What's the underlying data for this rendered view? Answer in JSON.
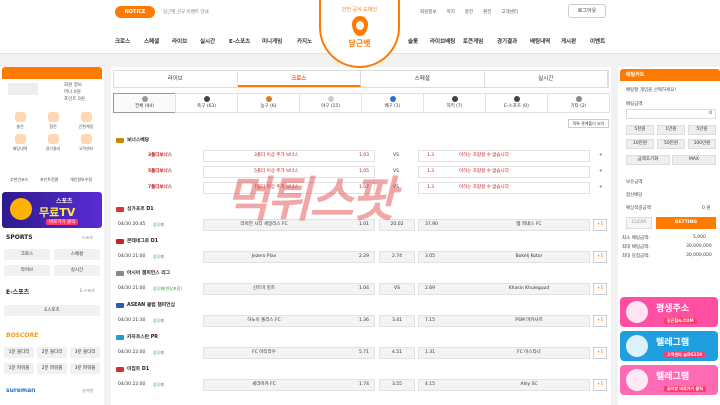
{
  "topbar": {
    "notice_label": "NOTICE",
    "notice_text": "당근벳 신규 이벤트 안내",
    "links": [
      "회원정보",
      "쪽지",
      "충전",
      "환전",
      "고객센터"
    ],
    "logout": "로그아웃"
  },
  "logo": {
    "sub": "안전 공식 도메인",
    "name": "당근벳"
  },
  "nav": {
    "items": [
      "크로스",
      "스페셜",
      "라이브",
      "실시간",
      "E-스포츠",
      "미니게임",
      "카지노",
      "슬롯",
      "라이브배팅",
      "토큰게임",
      "경기결과",
      "배팅내역",
      "게시판",
      "이벤트"
    ]
  },
  "left": {
    "user": {
      "line1": "",
      "line2": "회원 정보",
      "line3": "머니 0원",
      "line4": "포인트 0원"
    },
    "quick": [
      "충전",
      "환전",
      "간편계정",
      "배팅내역",
      "경기결과",
      "고객센터"
    ],
    "links": [
      "추천인코드",
      "포인트전환",
      "개인정보수정"
    ],
    "tv": {
      "t1": "스포츠",
      "t2": "무료TV",
      "t3": "바로가기 클릭"
    },
    "sports_title": "SPORTS",
    "sports_more": "스포츠",
    "sports_btns": [
      "크로스",
      "스페셜",
      "라이브",
      "실시간"
    ],
    "esports_title": "E-스포츠",
    "esports_more": "E-스포츠",
    "esports_btn": "E스포츠",
    "boscore": "BOSCORE",
    "boscore_btns": [
      "1분 볼다리",
      "2분 볼다리",
      "3분 볼다리",
      "1분 파워볼",
      "2분 파워볼",
      "3분 파워볼"
    ],
    "sureman": "sureman",
    "sureman_more": "슈어맨"
  },
  "main": {
    "tabs": [
      "라이브",
      "크로스",
      "스페셜",
      "실시간"
    ],
    "sports": [
      "전체 (94)",
      "축구 (63)",
      "농구 (6)",
      "야구 (15)",
      "배구 (1)",
      "하키 (7)",
      "E-스포츠 (0)",
      "기타 (2)"
    ],
    "relation_btn": "적특 관계폴더 보기",
    "bonus_league": "보너스배당",
    "bonus_rows": [
      {
        "name": "3폴더보너스",
        "detail": "3폴더 이상 추가 보너스",
        "odds": "1.03",
        "vs": "VS",
        "right_odds": "1.3",
        "msg": "이하는 조합할 수 없습니다"
      },
      {
        "name": "5폴더보너스",
        "detail": "5폴더 이상 추가 보너스",
        "odds": "1.05",
        "vs": "VS",
        "right_odds": "1.3",
        "msg": "이하는 조합할 수 없습니다"
      },
      {
        "name": "7폴더보너스",
        "detail": "7폴더 이상 추가 보너스",
        "odds": "1.07",
        "vs": "VS",
        "right_odds": "1.3",
        "msg": "이하는 조합할 수 없습니다"
      }
    ],
    "games": [
      {
        "league": "싱가포르 D1",
        "flag": "#d33",
        "time": "04/30 20:45",
        "type": "승무패",
        "home": "라이언 시티 세일러스 FC",
        "h": "1.01",
        "d": "20.02",
        "a": "37.90",
        "away": "탬 피네스 FC",
        "more": "+5"
      },
      {
        "league": "몬테네그로 D1",
        "flag": "#c22",
        "time": "04/30 21:00",
        "type": "승무패",
        "home": "Jezero Plav",
        "h": "2.29",
        "d": "2.74",
        "a": "3.05",
        "away": "Bokelj Kotor",
        "more": "+5"
      },
      {
        "league": "아시아 챔피언스 리그",
        "flag": "#888",
        "time": "04/30 21:00",
        "type": "승무패(연장포함)",
        "home": "신트미 킹즈",
        "h": "1.04",
        "d": "VS",
        "a": "2.69",
        "away": "Khasin Khuleguud",
        "more": "+5"
      },
      {
        "league": "ASEAN 클럽 챔피언십",
        "flag": "#2a5db0",
        "time": "04/30 21:30",
        "type": "승무패",
        "home": "하노이 폴리스 FC",
        "h": "1.36",
        "d": "3.41",
        "a": "7.15",
        "away": "PSM 마카사르",
        "more": "+5"
      },
      {
        "league": "카자흐스탄 PR",
        "flag": "#1fa0c9",
        "time": "04/30 22:00",
        "type": "승무패",
        "home": "FC 아티라우",
        "h": "5.71",
        "d": "4.51",
        "a": "1.31",
        "away": "FC 아스타나",
        "more": "+5"
      },
      {
        "league": "이집트 D1",
        "flag": "#c33",
        "time": "04/30 22:00",
        "type": "승무패",
        "home": "세라미카 FC",
        "h": "1.74",
        "d": "3.55",
        "a": "4.15",
        "away": "Ahly SC",
        "more": "+5"
      }
    ],
    "watermark": "먹튀스팟"
  },
  "right": {
    "cart_title": "배팅카트",
    "cart_msg": "배팅할 게임을 선택하세요!",
    "amount_label": "배팅금액",
    "amount_value": "0",
    "chips": [
      "5천원",
      "1만원",
      "5만원",
      "10만원",
      "50만원",
      "100만원"
    ],
    "reset": "금액초기화",
    "max": "MAX",
    "hold_label": "보유금액",
    "odds_label": "합산배당",
    "expect_label": "예상적중금액",
    "expect_value": "0 원",
    "clear": "CLEAR",
    "betting": "BETTING",
    "limits": [
      {
        "k": "최소 배팅금액:",
        "v": "5,000"
      },
      {
        "k": "최대 배팅금액:",
        "v": "30,000,000"
      },
      {
        "k": "최대 당첨금액:",
        "v": "30,000,000"
      }
    ],
    "ads": [
      {
        "t1": "평생주소",
        "t2": "당근접속.COM",
        "c": "#ff4fa3"
      },
      {
        "t1": "텔레그램",
        "t2": "고객센터 @DG119",
        "c": "#1f9fe0"
      },
      {
        "t1": "텔레그램",
        "t2": "공지방 바로가기 클릭",
        "c": "#ff6ab5"
      }
    ]
  }
}
